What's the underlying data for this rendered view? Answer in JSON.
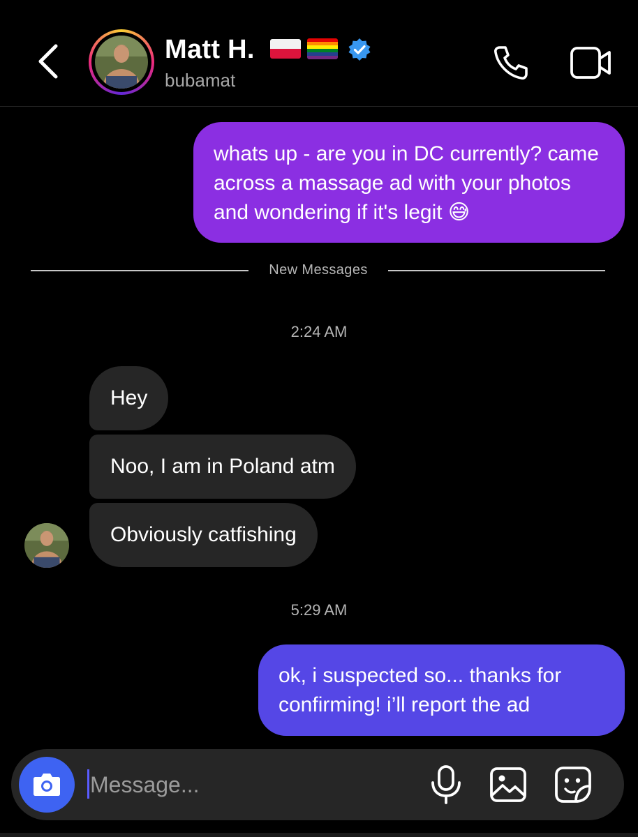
{
  "header": {
    "name": "Matt H.",
    "username": "bubamat",
    "flags": [
      "poland-flag",
      "rainbow-flag"
    ],
    "verified": true,
    "icons": {
      "back": "chevron-left-icon",
      "call": "phone-icon",
      "video": "video-camera-icon"
    }
  },
  "messages": [
    {
      "sender": "me",
      "text": "whats up - are you in DC currently? came across a massage ad with your photos and wondering if it's legit 😅"
    },
    {
      "type": "divider",
      "text": "New Messages"
    },
    {
      "type": "timestamp",
      "text": "2:24 AM"
    },
    {
      "sender": "them",
      "text": "Hey"
    },
    {
      "sender": "them",
      "text": "Noo, I am in Poland atm"
    },
    {
      "sender": "them",
      "text": "Obviously catfishing"
    },
    {
      "type": "timestamp",
      "text": "5:29 AM"
    },
    {
      "sender": "me",
      "text": "ok, i suspected so... thanks for confirming! i’ll report the ad"
    }
  ],
  "composer": {
    "placeholder": "Message...",
    "icons": [
      "camera-icon",
      "microphone-icon",
      "gallery-icon",
      "sticker-icon"
    ]
  },
  "colors": {
    "background": "#000000",
    "outgoing_bubble_1": "#8b2fe2",
    "outgoing_bubble_2": "#5547e6",
    "incoming_bubble": "#262626",
    "camera_button": "#3e63f2",
    "verified_badge": "#3897f0"
  }
}
